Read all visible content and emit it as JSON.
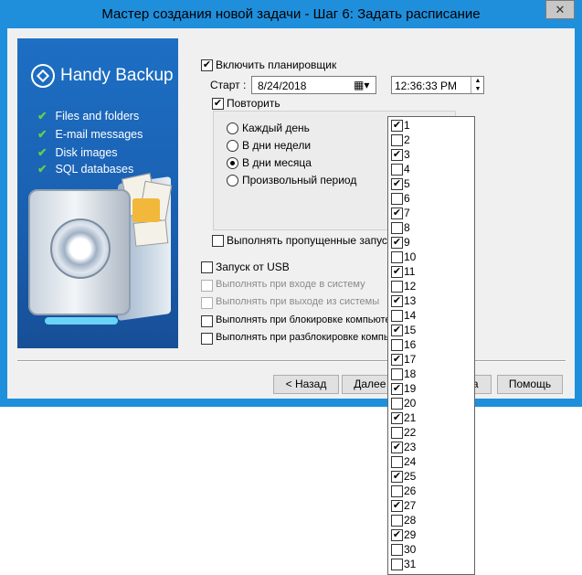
{
  "window": {
    "title": "Мастер создания новой задачи - Шаг 6: Задать расписание",
    "close_symbol": "✕"
  },
  "banner": {
    "logo_text": "Handy Backup",
    "features": [
      "Files and folders",
      "E-mail messages",
      "Disk images",
      "SQL databases"
    ]
  },
  "scheduler": {
    "enable_label": "Включить планировщик",
    "enable_checked": true,
    "start_label": "Старт :",
    "start_date": "8/24/2018",
    "start_time": "12:36:33 PM",
    "repeat_label": "Повторить",
    "repeat_checked": true,
    "repeat_options": [
      {
        "label": "Каждый день",
        "selected": false
      },
      {
        "label": "В дни недели",
        "selected": false
      },
      {
        "label": "В дни месяца",
        "selected": true
      },
      {
        "label": "Произвольный период",
        "selected": false
      }
    ],
    "missed_label": "Выполнять пропущенные запуски",
    "missed_checked": false
  },
  "triggers": [
    {
      "label": "Запуск от USB",
      "checked": false,
      "enabled": true
    },
    {
      "label": "Выполнять при входе в систему",
      "checked": false,
      "enabled": false
    },
    {
      "label": "Выполнять при выходе из системы",
      "checked": false,
      "enabled": false
    },
    {
      "label": "Выполнять при блокировке компьютера",
      "checked": false,
      "enabled": true
    },
    {
      "label": "Выполнять при разблокировке компьютера",
      "checked": false,
      "enabled": true
    }
  ],
  "buttons": {
    "back": "< Назад",
    "next": "Далее >",
    "cancel": "Отмена",
    "help": "Помощь"
  },
  "month_days": [
    {
      "day": "1",
      "checked": true
    },
    {
      "day": "2",
      "checked": false
    },
    {
      "day": "3",
      "checked": true
    },
    {
      "day": "4",
      "checked": false
    },
    {
      "day": "5",
      "checked": true
    },
    {
      "day": "6",
      "checked": false
    },
    {
      "day": "7",
      "checked": true
    },
    {
      "day": "8",
      "checked": false
    },
    {
      "day": "9",
      "checked": true
    },
    {
      "day": "10",
      "checked": false
    },
    {
      "day": "11",
      "checked": true
    },
    {
      "day": "12",
      "checked": false
    },
    {
      "day": "13",
      "checked": true
    },
    {
      "day": "14",
      "checked": false
    },
    {
      "day": "15",
      "checked": true
    },
    {
      "day": "16",
      "checked": false
    },
    {
      "day": "17",
      "checked": true
    },
    {
      "day": "18",
      "checked": false
    },
    {
      "day": "19",
      "checked": true
    },
    {
      "day": "20",
      "checked": false
    },
    {
      "day": "21",
      "checked": true
    },
    {
      "day": "22",
      "checked": false
    },
    {
      "day": "23",
      "checked": true
    },
    {
      "day": "24",
      "checked": false
    },
    {
      "day": "25",
      "checked": true
    },
    {
      "day": "26",
      "checked": false
    },
    {
      "day": "27",
      "checked": true
    },
    {
      "day": "28",
      "checked": false
    },
    {
      "day": "29",
      "checked": true
    },
    {
      "day": "30",
      "checked": false
    },
    {
      "day": "31",
      "checked": false
    }
  ],
  "colors": {
    "window_frame": "#1f8fdc",
    "banner_blue": "#1d6fc4",
    "check_green": "#62d04a"
  }
}
